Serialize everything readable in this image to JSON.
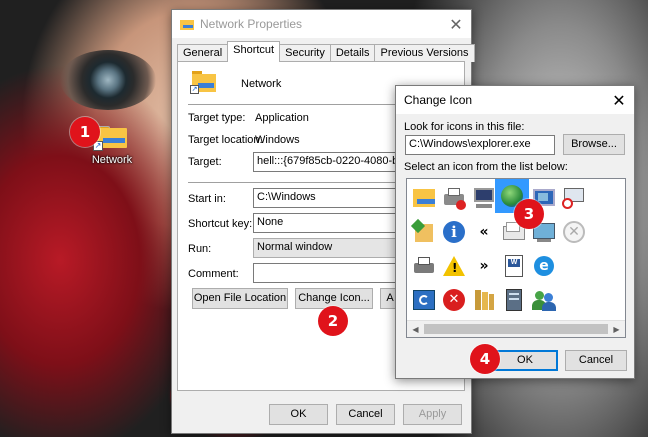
{
  "desktop": {
    "icon_label": "Network"
  },
  "badges": [
    "1",
    "2",
    "3",
    "4"
  ],
  "properties": {
    "title": "Network Properties",
    "tabs": [
      "General",
      "Shortcut",
      "Security",
      "Details",
      "Previous Versions"
    ],
    "selected_tab": "Shortcut",
    "name": "Network",
    "target_type_label": "Target type:",
    "target_type_value": "Application",
    "target_location_label": "Target location:",
    "target_location_value": "Windows",
    "target_label": "Target:",
    "target_value": "hell:::{679f85cb-0220-4080-b29b-55",
    "start_in_label": "Start in:",
    "start_in_value": "C:\\Windows",
    "shortcut_key_label": "Shortcut key:",
    "shortcut_key_value": "None",
    "run_label": "Run:",
    "run_value": "Normal window",
    "comment_label": "Comment:",
    "comment_value": "",
    "open_location_button": "Open File Location",
    "change_icon_button": "Change Icon...",
    "advanced_button_partial": "A",
    "ok_button": "OK",
    "cancel_button": "Cancel",
    "apply_button": "Apply"
  },
  "change_icon": {
    "title": "Change Icon",
    "look_for_label": "Look for icons in this file:",
    "file_value": "C:\\Windows\\explorer.exe",
    "browse_button": "Browse...",
    "select_label": "Select an icon from the list below:",
    "ok_button": "OK",
    "cancel_button": "Cancel",
    "icons": [
      "folder-icon",
      "printer-icon",
      "computer-icon",
      "globe-icon",
      "windows-icon",
      "blocked-monitor-icon",
      "folder-arrow-icon",
      "info-icon",
      "rewind-icon",
      "mail-icon",
      "network-screen-icon",
      "cancel-circle-icon",
      "printer-icon",
      "warning-icon",
      "fast-forward-icon",
      "document-icon",
      "internet-explorer-icon",
      "",
      "refresh-icon",
      "error-icon",
      "library-icon",
      "server-icon",
      "users-icon",
      ""
    ],
    "selected_icon": "globe-icon"
  }
}
